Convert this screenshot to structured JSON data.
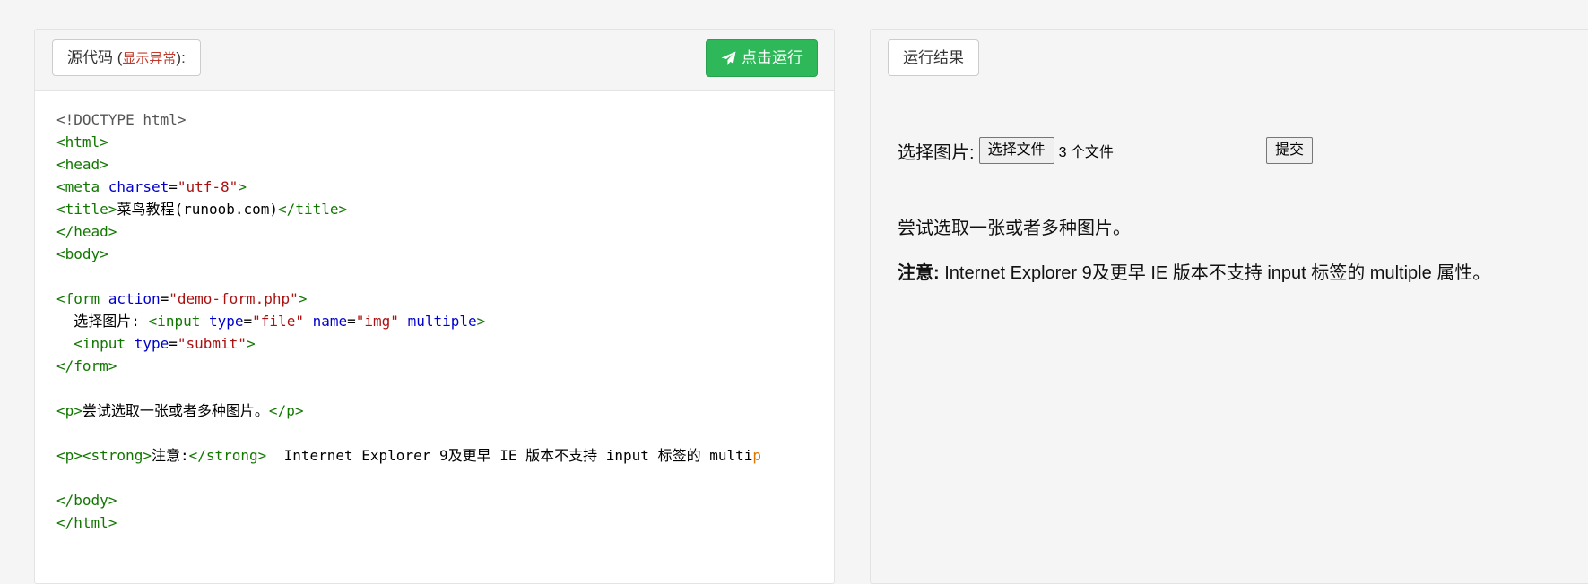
{
  "editor": {
    "header_label": "源代码",
    "paren_open": " (",
    "warning": "显示异常",
    "paren_close": "):",
    "run_button": "点击运行"
  },
  "code_lines": [
    [
      {
        "c": "t-doc",
        "t": "<!DOCTYPE html>"
      }
    ],
    [
      {
        "c": "t-tag",
        "t": "<html>"
      }
    ],
    [
      {
        "c": "t-tag",
        "t": "<head>"
      }
    ],
    [
      {
        "c": "t-tag",
        "t": "<meta "
      },
      {
        "c": "t-attr",
        "t": "charset"
      },
      {
        "c": "t-txt",
        "t": "="
      },
      {
        "c": "t-str",
        "t": "\"utf-8\""
      },
      {
        "c": "t-tag",
        "t": ">"
      }
    ],
    [
      {
        "c": "t-tag",
        "t": "<title>"
      },
      {
        "c": "t-txt",
        "t": "菜鸟教程(runoob.com)"
      },
      {
        "c": "t-tag",
        "t": "</title>"
      }
    ],
    [
      {
        "c": "t-tag",
        "t": "</head>"
      }
    ],
    [
      {
        "c": "t-tag",
        "t": "<body>"
      }
    ],
    [],
    [
      {
        "c": "t-tag",
        "t": "<form "
      },
      {
        "c": "t-attr",
        "t": "action"
      },
      {
        "c": "t-txt",
        "t": "="
      },
      {
        "c": "t-str",
        "t": "\"demo-form.php\""
      },
      {
        "c": "t-tag",
        "t": ">"
      }
    ],
    [
      {
        "c": "t-txt",
        "t": "  选择图片: "
      },
      {
        "c": "t-tag",
        "t": "<input "
      },
      {
        "c": "t-attr",
        "t": "type"
      },
      {
        "c": "t-txt",
        "t": "="
      },
      {
        "c": "t-str",
        "t": "\"file\""
      },
      {
        "c": "t-txt",
        "t": " "
      },
      {
        "c": "t-attr",
        "t": "name"
      },
      {
        "c": "t-txt",
        "t": "="
      },
      {
        "c": "t-str",
        "t": "\"img\""
      },
      {
        "c": "t-txt",
        "t": " "
      },
      {
        "c": "t-attr",
        "t": "multiple"
      },
      {
        "c": "t-tag",
        "t": ">"
      }
    ],
    [
      {
        "c": "t-txt",
        "t": "  "
      },
      {
        "c": "t-tag",
        "t": "<input "
      },
      {
        "c": "t-attr",
        "t": "type"
      },
      {
        "c": "t-txt",
        "t": "="
      },
      {
        "c": "t-str",
        "t": "\"submit\""
      },
      {
        "c": "t-tag",
        "t": ">"
      }
    ],
    [
      {
        "c": "t-tag",
        "t": "</form>"
      }
    ],
    [],
    [
      {
        "c": "t-tag",
        "t": "<p>"
      },
      {
        "c": "t-txt",
        "t": "尝试选取一张或者多种图片。"
      },
      {
        "c": "t-tag",
        "t": "</p>"
      }
    ],
    [],
    [
      {
        "c": "t-tag",
        "t": "<p><strong>"
      },
      {
        "c": "t-txt",
        "t": "注意:"
      },
      {
        "c": "t-tag",
        "t": "</strong>"
      },
      {
        "c": "t-txt",
        "t": "  Internet Explorer 9及更早 IE 版本不支持 input 标签的 multi"
      },
      {
        "c": "t-cut",
        "t": "p"
      }
    ],
    [],
    [
      {
        "c": "t-tag",
        "t": "</body>"
      }
    ],
    [
      {
        "c": "t-tag",
        "t": "</html>"
      }
    ]
  ],
  "result": {
    "header_label": "运行结果",
    "form_label": "选择图片:",
    "file_button": "选择文件",
    "file_count": "3 个文件",
    "submit_button": "提交",
    "para1": "尝试选取一张或者多种图片。",
    "note_bold": "注意:",
    "note_text": " Internet Explorer 9及更早 IE 版本不支持 input 标签的 multiple 属性。"
  },
  "icons": {
    "run": "paper-plane-icon"
  }
}
